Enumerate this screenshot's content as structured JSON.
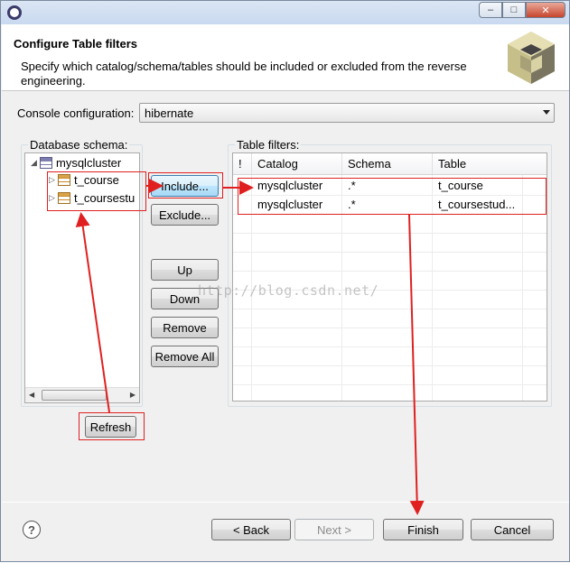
{
  "header": {
    "title": "Configure Table filters",
    "description": "Specify which catalog/schema/tables should be included or excluded from the reverse engineering."
  },
  "console": {
    "label": "Console configuration:",
    "value": "hibernate"
  },
  "schema": {
    "label": "Database schema:",
    "root": "mysqlcluster",
    "children": [
      "t_course",
      "t_coursestu"
    ]
  },
  "buttons": {
    "include": "Include...",
    "exclude": "Exclude...",
    "up": "Up",
    "down": "Down",
    "remove": "Remove",
    "remove_all": "Remove All",
    "refresh": "Refresh"
  },
  "filters": {
    "label": "Table filters:",
    "columns": [
      "!",
      "Catalog",
      "Schema",
      "Table"
    ],
    "rows": [
      {
        "flag": "",
        "catalog": "mysqlcluster",
        "schema": ".*",
        "table": "t_course"
      },
      {
        "flag": "",
        "catalog": "mysqlcluster",
        "schema": ".*",
        "table": "t_coursestud..."
      }
    ]
  },
  "footer": {
    "back": "< Back",
    "next": "Next >",
    "finish": "Finish",
    "cancel": "Cancel"
  },
  "watermark": "http://blog.csdn.net/",
  "colors": {
    "annotation": "#e02020",
    "selection": "#cce8ff"
  }
}
